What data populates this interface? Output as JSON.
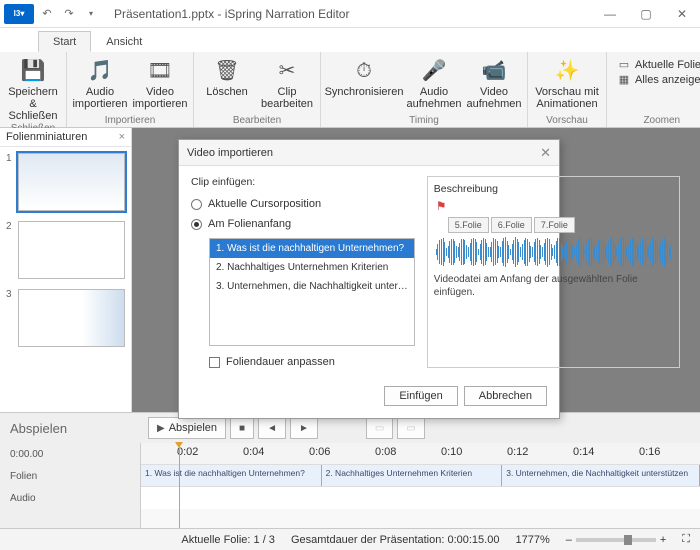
{
  "title": "Präsentation1.pptx - iSpring Narration Editor",
  "logo": "I3▾",
  "tabs": {
    "start": "Start",
    "view": "Ansicht"
  },
  "ribbon": {
    "save": "Speichern\n& Schließen",
    "close_group": "Schließen",
    "audio_import": "Audio\nimportieren",
    "video_import": "Video\nimportieren",
    "import_group": "Importieren",
    "delete": "Löschen",
    "clip_edit": "Clip\nbearbeiten",
    "edit_group": "Bearbeiten",
    "sync": "Synchronisieren",
    "audio_rec": "Audio\naufnehmen",
    "video_rec": "Video\naufnehmen",
    "timing_group": "Timing",
    "preview": "Vorschau mit\nAnimationen",
    "preview_group": "Vorschau",
    "current_slide": "Aktuelle Folie",
    "show_all": "Alles anzeigen",
    "zoom_group": "Zoomen"
  },
  "thumbpane": {
    "title": "Folienminiaturen"
  },
  "dialog": {
    "title": "Video importieren",
    "clip_insert": "Clip einfügen:",
    "radio_cursor": "Aktuelle Cursorposition",
    "radio_start": "Am Folienanfang",
    "slides": [
      "1. Was ist die nachhaltigen Unternehmen?",
      "2. Nachhaltiges Unternehmen Kriterien",
      "3. Unternehmen, die Nachhaltigkeit unter…"
    ],
    "adjust_duration": "Foliendauer anpassen",
    "description_label": "Beschreibung",
    "tab5": "5.Folie",
    "tab6": "6.Folie",
    "tab7": "7.Folie",
    "desc_text": "Videodatei am Anfang der ausgewählten Folie einfügen.",
    "insert": "Einfügen",
    "cancel": "Abbrechen"
  },
  "timeline": {
    "play_section": "Abspielen",
    "play_btn": "Abspielen",
    "time0": "0:00.00",
    "folien": "Folien",
    "audio": "Audio",
    "ticks": [
      "0:02",
      "0:04",
      "0:06",
      "0:08",
      "0:10",
      "0:12",
      "0:14",
      "0:16"
    ],
    "s1": "1. Was ist die nachhaltigen Unternehmen?",
    "s2": "2. Nachhaltiges Unternehmen Kriterien",
    "s3": "3. Unternehmen, die Nachhaltigkeit unterstützen"
  },
  "status": {
    "slide": "Aktuelle Folie: 1 / 3",
    "duration": "Gesamtdauer der Präsentation: 0:00:15.00",
    "zoom": "1777%"
  }
}
